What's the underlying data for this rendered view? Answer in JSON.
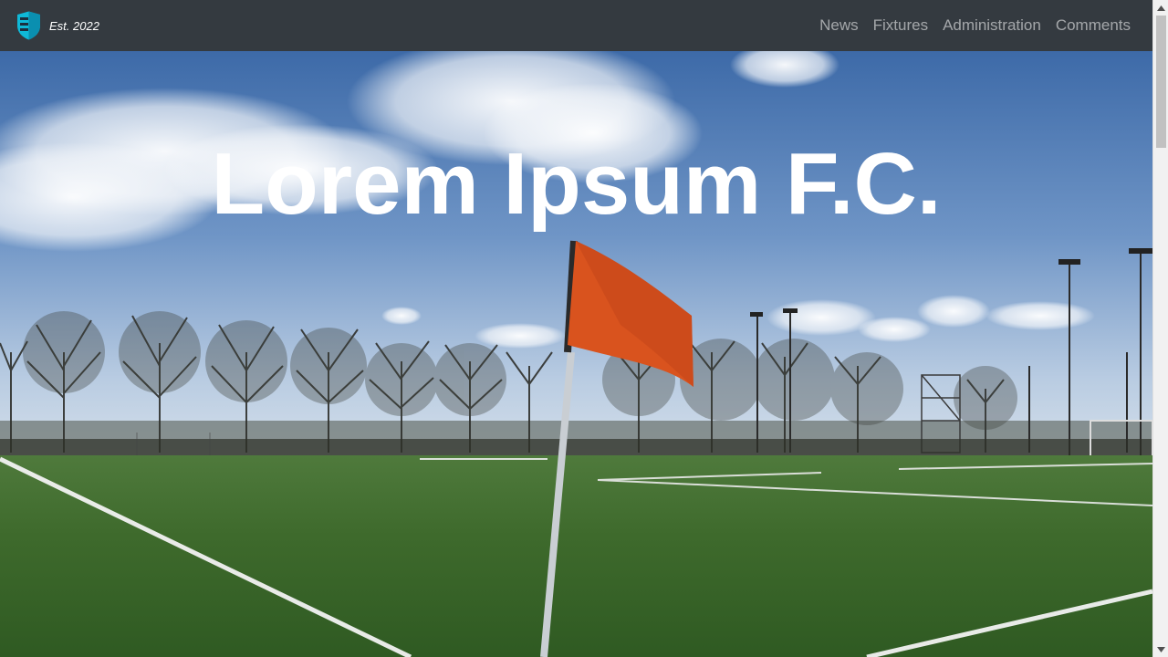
{
  "navbar": {
    "brand_icon": "shield-icon",
    "brand_text": "Est. 2022",
    "links": [
      {
        "label": "News"
      },
      {
        "label": "Fixtures"
      },
      {
        "label": "Administration"
      },
      {
        "label": "Comments"
      }
    ]
  },
  "hero": {
    "title": "Lorem Ipsum F.C.",
    "image": "football-pitch-corner-flag"
  },
  "colors": {
    "navbar_bg": "#343a40",
    "nav_link": "rgba(255,255,255,0.55)",
    "brand_accent": "#17a2b8",
    "flag": "#d9531e"
  }
}
